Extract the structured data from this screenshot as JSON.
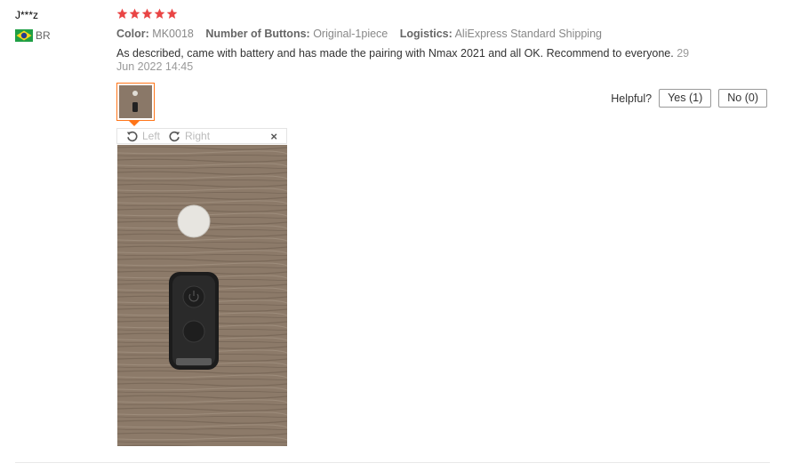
{
  "review": {
    "user": "J***z",
    "country_code": "BR",
    "rating": 5,
    "attributes": {
      "color_label": "Color:",
      "color_value": "MK0018",
      "buttons_label": "Number of Buttons:",
      "buttons_value": "Original-1piece",
      "logistics_label": "Logistics:",
      "logistics_value": "AliExpress Standard Shipping"
    },
    "text": "As described, came with battery and has made the pairing with Nmax 2021 and all OK. Recommend to everyone.",
    "date": "29 Jun 2022 14:45",
    "helpful_label": "Helpful?",
    "yes_label": "Yes (1)",
    "no_label": "No (0)"
  },
  "viewer": {
    "rotate_left_label": "Left",
    "rotate_right_label": "Right",
    "close_label": "×"
  },
  "colors": {
    "star": "#e94545",
    "accent": "#ff7519",
    "wood": "#8a7868"
  }
}
